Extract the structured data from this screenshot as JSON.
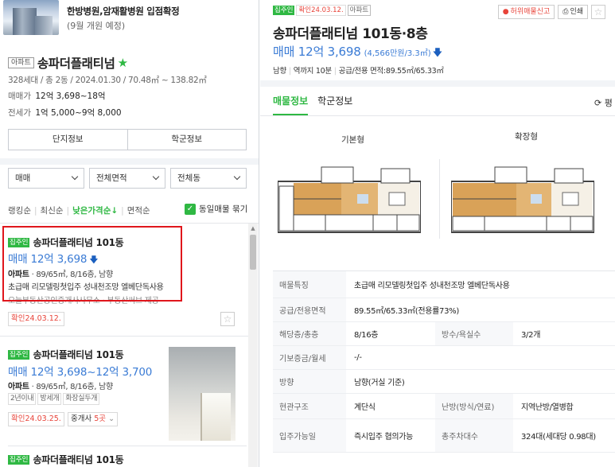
{
  "news": {
    "title": "한방병원,암재활병원 입점확정",
    "subtitle": "(9월 개원 예정)"
  },
  "complex": {
    "type_tag": "아파트",
    "name": "송파더플래티넘",
    "star": "★",
    "meta": "328세대 / 총 2동 / 2024.01.30 / 70.48㎡ ~ 138.82㎡",
    "sale_label": "매매가",
    "sale_value": "12억 3,698~18억",
    "lease_label": "전세가",
    "lease_value": "1억 5,000~9억 8,000",
    "buttons": [
      "단지정보",
      "학군정보"
    ]
  },
  "filters": {
    "trade": "매매",
    "area": "전체면적",
    "dong": "전체동"
  },
  "sorts": {
    "items": [
      "랭킹순",
      "최신순",
      "낮은가격순↓",
      "면적순"
    ],
    "active_index": 2,
    "same_listing_label": "동일매물 묶기"
  },
  "listings": [
    {
      "badge": "집주인",
      "name": "송파더플래티넘 101동",
      "price": "매매 12억 3,698",
      "spec_type": "아파트",
      "spec": "· 89/65㎡, 8/16층, 남향",
      "desc": "초급매 리모델링첫입주 성내천조망 엘베단독사용",
      "desc2": "오늘부동산공인중개사사무소 · 부동산써브 제공",
      "confirm": "확인24.03.12."
    },
    {
      "badge": "집주인",
      "name": "송파더플래티넘 101동",
      "price": "매매 12억 3,698~12억 3,700",
      "spec_type": "아파트",
      "spec": "· 89/65㎡, 8/16층, 남향",
      "tags": [
        "2년이내",
        "방세개",
        "화장실두개"
      ],
      "confirm": "확인24.03.25.",
      "agent_label": "중개사",
      "agent_count": "5곳"
    },
    {
      "badge": "집주인",
      "name": "송파더플래티넘 101동"
    }
  ],
  "detail": {
    "badge": "집주인",
    "confirm_tag": "확인24.03.12.",
    "type_tag": "아파트",
    "report_label": "허위매물신고",
    "print_label": "인쇄",
    "title": "송파더플래티넘 101동·8층",
    "price": "매매 12억 3,698",
    "price_unit": "(4,566만원/3.3㎡)",
    "summary": [
      "남향",
      "역까지 10분",
      "공급/전용 면적:89.55㎡/65.33㎡"
    ],
    "tabs": [
      "매물정보",
      "학군정보"
    ],
    "tab_right": "⟳ 평",
    "floorplan_labels": [
      "기본형",
      "확장형"
    ],
    "table": {
      "feature_label": "매물특징",
      "feature_value": "초급매 리모델링첫입주 성내천조망 엘베단독사용",
      "area_label": "공급/전용면적",
      "area_value": "89.55㎡/65.33㎡(전용률73%)",
      "floor_label": "해당층/총층",
      "floor_value": "8/16층",
      "room_label": "방수/욕실수",
      "room_value": "3/2개",
      "deposit_label": "기보증금/월세",
      "deposit_value": "-/-",
      "dir_label": "방향",
      "dir_value": "남향(거실 기준)",
      "entrance_label": "현관구조",
      "entrance_value": "계단식",
      "heating_label": "난방(방식/연료)",
      "heating_value": "지역난방/열병합",
      "movein_label": "입주가능일",
      "movein_value": "즉시입주 협의가능",
      "parking_label": "총주차대수",
      "parking_value": "324대(세대당 0.98대)"
    }
  },
  "colors": {
    "green": "#2fb843",
    "blue_price": "#3a7bd5",
    "red": "#e8443a",
    "highlight": "#e0161c"
  }
}
